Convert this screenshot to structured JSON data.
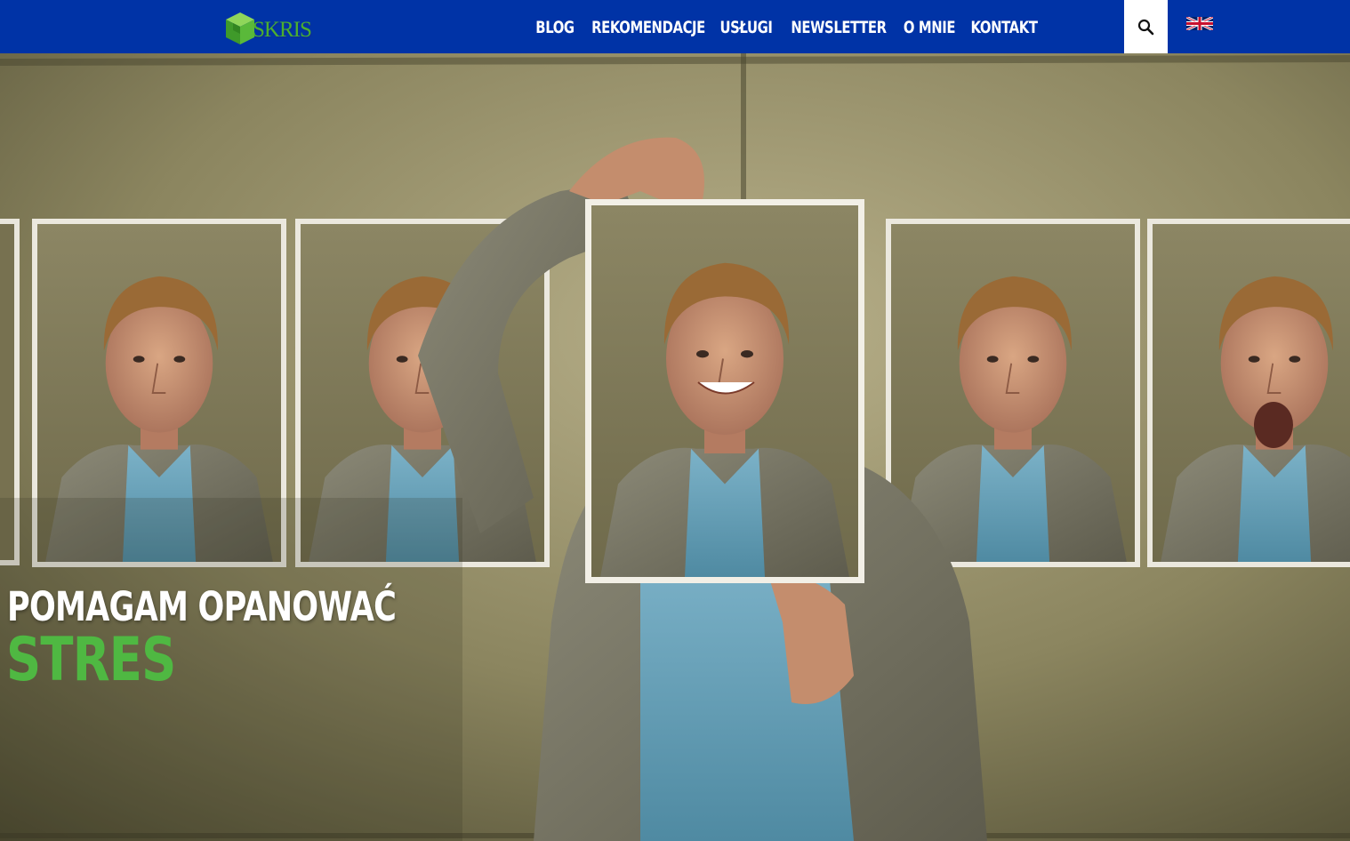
{
  "brand": {
    "logo_text": "SKRIS"
  },
  "nav": {
    "items": [
      {
        "label": "BLOG"
      },
      {
        "label": "REKOMENDACJE"
      },
      {
        "label": "USŁUGI"
      },
      {
        "label": "NEWSLETTER"
      },
      {
        "label": "O MNIE"
      },
      {
        "label": "KONTAKT"
      }
    ],
    "search_icon": "search-icon",
    "language_flag": "uk-flag-icon"
  },
  "hero": {
    "headline_line1": "POMAGAM OPANOWAĆ",
    "headline_line2": "STRES"
  },
  "colors": {
    "nav_background": "#0033a6",
    "accent_green": "#4fb842",
    "headline_white": "#ffffff"
  }
}
